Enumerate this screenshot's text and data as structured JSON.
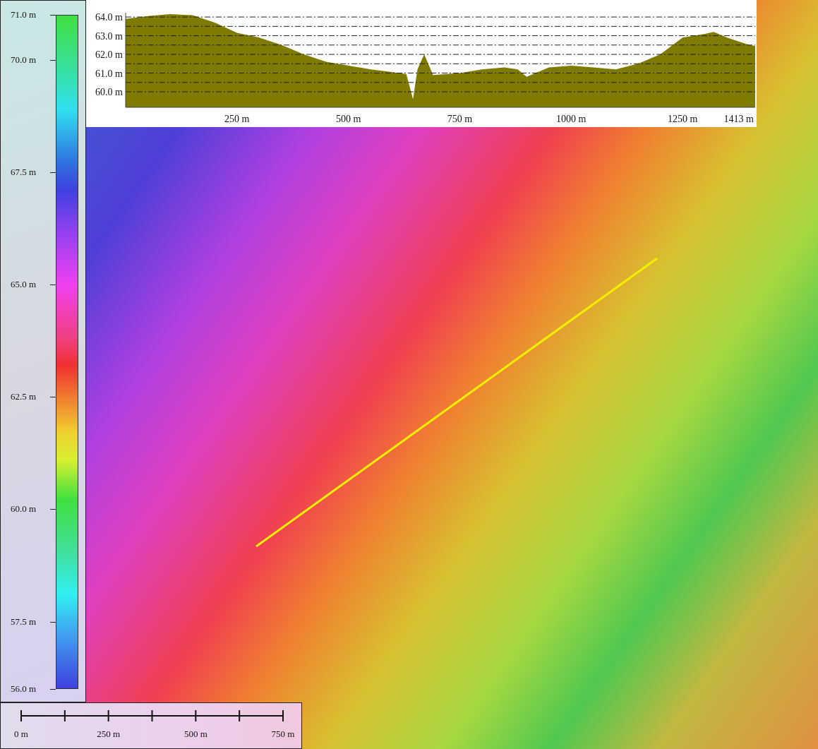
{
  "legend": {
    "labels": [
      "71.0 m",
      "70.0 m",
      "67.5 m",
      "65.0 m",
      "62.5 m",
      "60.0 m",
      "57.5 m",
      "56.0 m"
    ]
  },
  "profile": {
    "chart_data": {
      "type": "area",
      "x": [
        0,
        50,
        100,
        150,
        200,
        250,
        300,
        350,
        400,
        450,
        500,
        550,
        600,
        630,
        645,
        655,
        670,
        690,
        750,
        800,
        850,
        880,
        900,
        950,
        1000,
        1050,
        1100,
        1150,
        1200,
        1250,
        1300,
        1320,
        1350,
        1400,
        1413
      ],
      "series": [
        {
          "color": "#7f7a00",
          "values": [
            63.9,
            64.05,
            64.15,
            64.1,
            63.7,
            63.15,
            62.9,
            62.5,
            62.0,
            61.6,
            61.4,
            61.2,
            61.05,
            60.95,
            59.6,
            61.2,
            62.0,
            60.9,
            61.0,
            61.2,
            61.3,
            61.2,
            60.8,
            61.3,
            61.4,
            61.3,
            61.2,
            61.5,
            62.0,
            62.9,
            63.1,
            63.2,
            62.9,
            62.5,
            62.45
          ]
        }
      ],
      "xlim": [
        0,
        1413
      ],
      "ylim": [
        59.17,
        64.23
      ],
      "grid": true,
      "xticks": [
        {
          "value": 250,
          "label": "250 m"
        },
        {
          "value": 500,
          "label": "500 m"
        },
        {
          "value": 750,
          "label": "750 m"
        },
        {
          "value": 1000,
          "label": "1000 m"
        },
        {
          "value": 1250,
          "label": "1250 m"
        },
        {
          "value": 1413,
          "label": "1413 m"
        }
      ],
      "yticks": [
        {
          "value": 60,
          "label": "60.0 m"
        },
        {
          "value": 61,
          "label": "61.0 m"
        },
        {
          "value": 62,
          "label": "62.0 m"
        },
        {
          "value": 63,
          "label": "63.0 m"
        },
        {
          "value": 64,
          "label": "64.0 m"
        }
      ]
    }
  },
  "scale_bar": {
    "labels": [
      "0 m",
      "250 m",
      "500 m",
      "750 m"
    ]
  }
}
